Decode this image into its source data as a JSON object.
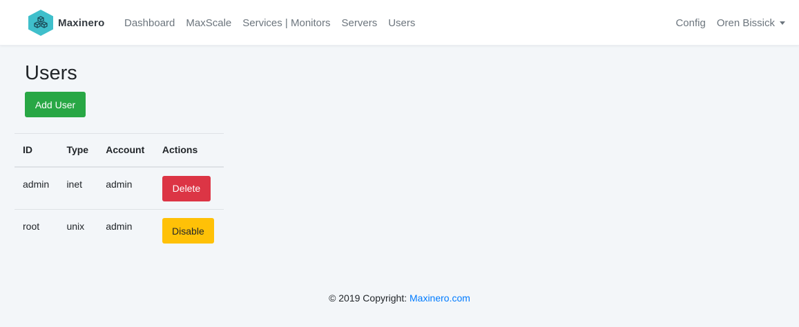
{
  "brand": {
    "name": "Maxinero",
    "logo_icon": "hexagon-cubes-icon",
    "logo_color": "#3fbfcb"
  },
  "nav": {
    "items": [
      {
        "label": "Dashboard"
      },
      {
        "label": "MaxScale"
      },
      {
        "label": "Services | Monitors"
      },
      {
        "label": "Servers"
      },
      {
        "label": "Users"
      }
    ],
    "config": "Config",
    "user_menu": "Oren Bissick"
  },
  "page": {
    "title": "Users",
    "add_button": "Add User"
  },
  "table": {
    "headers": [
      "ID",
      "Type",
      "Account",
      "Actions"
    ],
    "rows": [
      {
        "id": "admin",
        "type": "inet",
        "account": "admin",
        "action": "Delete",
        "action_color": "#dc3545"
      },
      {
        "id": "root",
        "type": "unix",
        "account": "admin",
        "action": "Disable",
        "action_color": "#ffc107"
      }
    ]
  },
  "footer": {
    "text": "© 2019 Copyright:",
    "link": "Maxinero.com"
  }
}
